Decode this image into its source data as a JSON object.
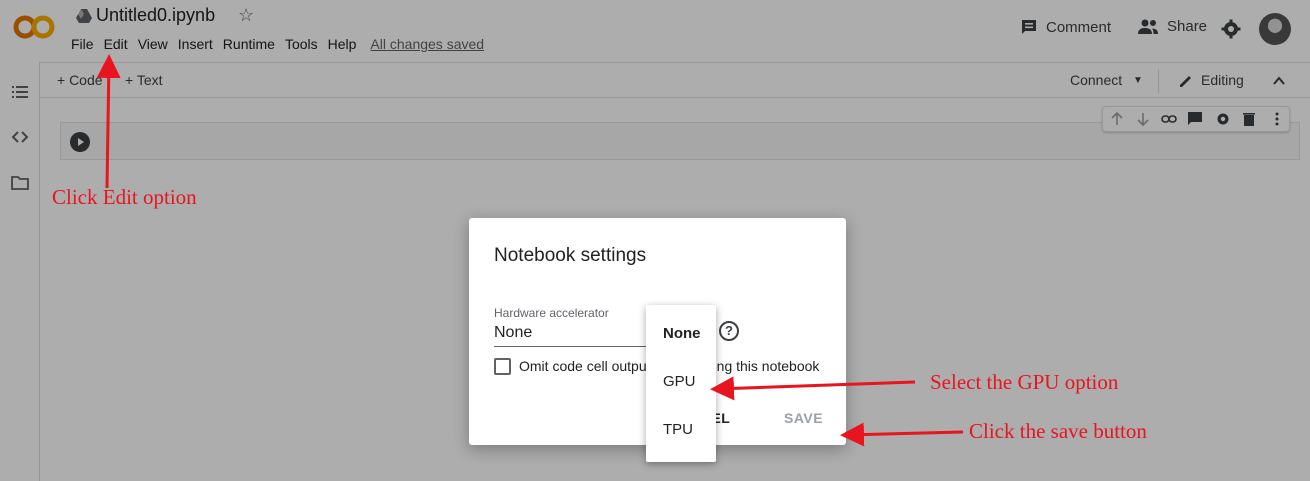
{
  "header": {
    "title": "Untitled0.ipynb",
    "menu": [
      "File",
      "Edit",
      "View",
      "Insert",
      "Runtime",
      "Tools",
      "Help"
    ],
    "saved_status": "All changes saved",
    "comment_label": "Comment",
    "share_label": "Share"
  },
  "toolbar": {
    "add_code": "+ Code",
    "add_text": "+ Text",
    "connect": "Connect",
    "editing": "Editing"
  },
  "dialog": {
    "title": "Notebook settings",
    "hw_label": "Hardware accelerator",
    "hw_value": "None",
    "omit_text": "Omit code cell output when saving this notebook",
    "cancel": "CANCEL",
    "save": "SAVE"
  },
  "dropdown": {
    "options": [
      "None",
      "GPU",
      "TPU"
    ],
    "selected": "None"
  },
  "annotations": {
    "edit": "Click Edit option",
    "gpu": "Select the GPU option",
    "save": "Click the save button"
  },
  "colors": {
    "annotation": "#e8141e",
    "logo": "#e37400"
  }
}
